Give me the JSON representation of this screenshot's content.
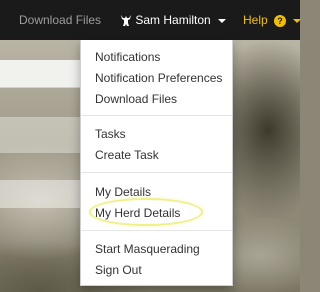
{
  "navbar": {
    "download_files_label": "Download Files",
    "user": {
      "icon": "cow-icon",
      "name": "Sam Hamilton"
    },
    "help": {
      "label": "Help",
      "icon": "question-circle-icon"
    }
  },
  "dropdown": {
    "items": [
      {
        "label": "Notifications"
      },
      {
        "label": "Notification Preferences"
      },
      {
        "label": "Download Files"
      },
      {
        "label": "Tasks"
      },
      {
        "label": "Create Task"
      },
      {
        "label": "My Details"
      },
      {
        "label": "My Herd Details",
        "highlighted": true
      },
      {
        "label": "Start Masquerading"
      },
      {
        "label": "Sign Out"
      }
    ]
  },
  "colors": {
    "navbar_bg": "#1a1a1a",
    "help_accent": "#f0c000",
    "highlight_ring": "#eff08a"
  }
}
